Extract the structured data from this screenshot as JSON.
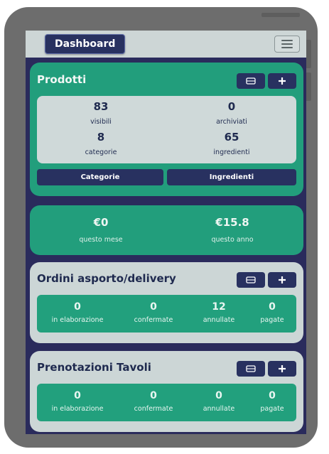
{
  "app": {
    "brand": "Dashboard",
    "menu_icon": "hamburger-icon"
  },
  "products": {
    "title": "Prodotti",
    "stats": [
      {
        "value": "83",
        "label": "visibili"
      },
      {
        "value": "0",
        "label": "archiviati"
      },
      {
        "value": "8",
        "label": "categorie"
      },
      {
        "value": "65",
        "label": "ingredienti"
      }
    ],
    "categories_button": "Categorie",
    "ingredients_button": "Ingredienti",
    "list_icon": "list-icon",
    "add_icon": "plus-icon"
  },
  "revenue": {
    "month_value": "€0",
    "month_label": "questo mese",
    "year_value": "€15.8",
    "year_label": "questo anno"
  },
  "orders": {
    "title": "Ordini asporto/delivery",
    "stats": [
      {
        "value": "0",
        "label": "in elaborazione"
      },
      {
        "value": "0",
        "label": "confermate"
      },
      {
        "value": "12",
        "label": "annullate"
      },
      {
        "value": "0",
        "label": "pagate"
      }
    ]
  },
  "reservations": {
    "title": "Prenotazioni Tavoli",
    "stats": [
      {
        "value": "0",
        "label": "in elaborazione"
      },
      {
        "value": "0",
        "label": "confermate"
      },
      {
        "value": "0",
        "label": "annullate"
      },
      {
        "value": "0",
        "label": "pagate"
      }
    ]
  },
  "colors": {
    "navy": "#283160",
    "green": "#229e7c",
    "light_gray": "#ccd6d6",
    "background": "#2a2b5c"
  }
}
